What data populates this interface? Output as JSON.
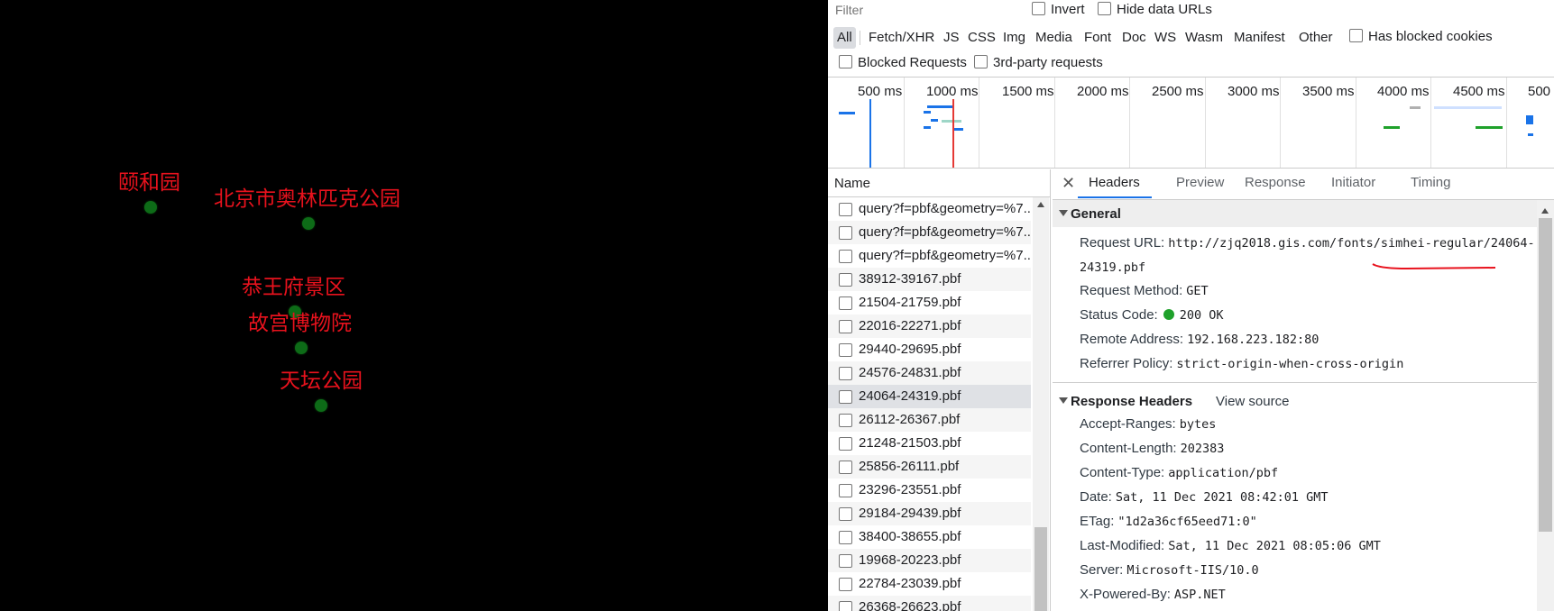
{
  "map": {
    "pois": [
      {
        "label": "颐和园"
      },
      {
        "label": "北京市奥林匹克公园"
      },
      {
        "label": "恭王府景区"
      },
      {
        "label": "故宫博物院"
      },
      {
        "label": "天坛公园"
      }
    ]
  },
  "devtools": {
    "filter": {
      "placeholder": "Filter"
    },
    "options": {
      "invert": "Invert",
      "hide_data_urls": "Hide data URLs",
      "has_blocked_cookies": "Has blocked cookies",
      "blocked_requests": "Blocked Requests",
      "third_party": "3rd-party requests"
    },
    "types": [
      "All",
      "Fetch/XHR",
      "JS",
      "CSS",
      "Img",
      "Media",
      "Font",
      "Doc",
      "WS",
      "Wasm",
      "Manifest",
      "Other"
    ],
    "timeline_labels": [
      "500 ms",
      "1000 ms",
      "1500 ms",
      "2000 ms",
      "2500 ms",
      "3000 ms",
      "3500 ms",
      "4000 ms",
      "4500 ms",
      "500"
    ],
    "list": {
      "header": "Name",
      "requests": [
        "query?f=pbf&geometry=%7...",
        "query?f=pbf&geometry=%7...",
        "query?f=pbf&geometry=%7...",
        "38912-39167.pbf",
        "21504-21759.pbf",
        "22016-22271.pbf",
        "29440-29695.pbf",
        "24576-24831.pbf",
        "24064-24319.pbf",
        "26112-26367.pbf",
        "21248-21503.pbf",
        "25856-26111.pbf",
        "23296-23551.pbf",
        "29184-29439.pbf",
        "38400-38655.pbf",
        "19968-20223.pbf",
        "22784-23039.pbf",
        "26368-26623.pbf"
      ],
      "selected_index": 8
    },
    "tabs": [
      "Headers",
      "Preview",
      "Response",
      "Initiator",
      "Timing"
    ],
    "general": {
      "title": "General",
      "request_url_key": "Request URL:",
      "request_url_line1": "http://zjq2018.gis.com/fonts/simhei-regular/24064-",
      "request_url_line2": "24319.pbf",
      "method_key": "Request Method:",
      "method": "GET",
      "status_key": "Status Code:",
      "status": "200 OK",
      "remote_key": "Remote Address:",
      "remote": "192.168.223.182:80",
      "referrer_key": "Referrer Policy:",
      "referrer": "strict-origin-when-cross-origin"
    },
    "response_headers": {
      "title": "Response Headers",
      "view_source": "View source",
      "items": [
        {
          "k": "Accept-Ranges:",
          "v": "bytes"
        },
        {
          "k": "Content-Length:",
          "v": "202383"
        },
        {
          "k": "Content-Type:",
          "v": "application/pbf"
        },
        {
          "k": "Date:",
          "v": "Sat, 11 Dec 2021 08:42:01 GMT"
        },
        {
          "k": "ETag:",
          "v": "\"1d2a36cf65eed71:0\""
        },
        {
          "k": "Last-Modified:",
          "v": "Sat, 11 Dec 2021 08:05:06 GMT"
        },
        {
          "k": "Server:",
          "v": "Microsoft-IIS/10.0"
        },
        {
          "k": "X-Powered-By:",
          "v": "ASP.NET"
        }
      ]
    },
    "colors": {
      "accent": "#1a73e8",
      "status_ok": "#1fa12b",
      "annotation": "#e8121d"
    }
  }
}
